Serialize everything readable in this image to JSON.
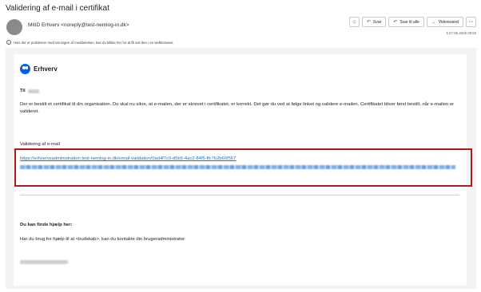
{
  "email": {
    "subject": "Validering af e-mail i certifikat",
    "sender": "MitID Erhverv <noreply@test-nemlog-in.dk>",
    "info_line": "Hvis der er problemer med visningen af meddelelsen, kan du klikke her for at få vist den i en webbrowser.",
    "timestamp": "ti 27-05-2025 09:55"
  },
  "toolbar": {
    "emoji_icon": "smiley-icon",
    "reply_label": "Svar",
    "reply_all_label": "Svar til alle",
    "forward_label": "Videresend",
    "more_icon": "more-icon"
  },
  "body": {
    "brand_name": "Erhverv",
    "greeting_prefix": "Til",
    "paragraph": "Der er bestilt et certifikat til din organisation. Du skal nu sikre, at e-mailen, der er skrevet i certifikatet, er korrekt. Det gør du ved at følge linket og validere e-mailen. Certifikatet bliver først bestilt, når e-mailen er valideret.",
    "validation_label": "Validering af e-mail",
    "validation_link": "https://erhvervsadministration.test-nemlog-in.dk/email-validation/0ad4f7c0-d5b5-4ac2-84f6-ffc7b2b66f567",
    "help_title": "Du kan finde hjælp her:",
    "help_text": "Har du brug for hjælp til at <budskab>, kan du kontakte din brugeradministrator:"
  },
  "colors": {
    "link": "#1a6fd6",
    "highlight_box": "#b01c1c",
    "brand": "#0060e6"
  }
}
